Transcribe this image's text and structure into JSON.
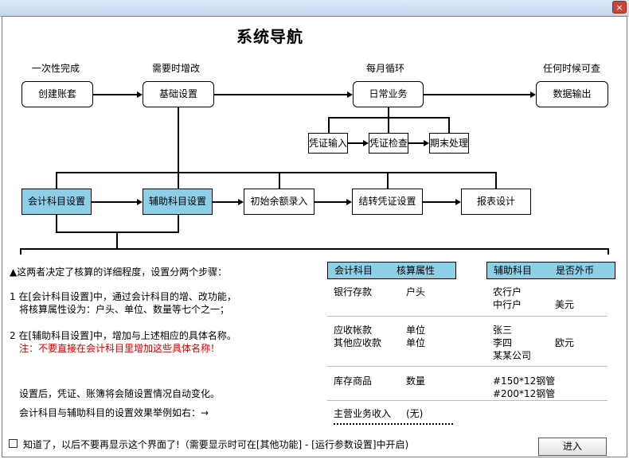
{
  "window": {
    "close_glyph": "×"
  },
  "title": "系统导航",
  "flow": {
    "top_labels": [
      "一次性完成",
      "需要时增改",
      "每月循环",
      "任何时候可查"
    ],
    "top_boxes": [
      "创建账套",
      "基础设置",
      "日常业务",
      "数据输出"
    ],
    "sub_boxes": [
      "凭证输入",
      "凭证检查",
      "期末处理"
    ],
    "mid_boxes": [
      "会计科目设置",
      "辅助科目设置",
      "初始余额录入",
      "结转凭证设置",
      "报表设计"
    ]
  },
  "notes": {
    "intro": "▲这两者决定了核算的详细程度，设置分两个步骤：",
    "step1_line1": "1 在[会计科目设置]中，通过会计科目的增、改功能，",
    "step1_line2": "将核算属性设为：户头、单位、数量等七个之一；",
    "step2_line1": "2 在[辅助科目设置]中，增加与上述相应的具体名称。",
    "step2_warning": "注：不要直接在会计科目里增加这些具体名称！",
    "after_setup": "设置后，凭证、账簿将会随设置情况自动变化。",
    "example_intro": "会计科目与辅助科目的设置效果举例如右：→"
  },
  "table": {
    "left_headers": [
      "会计科目",
      "核算属性"
    ],
    "right_headers": [
      "辅助科目",
      "是否外币"
    ],
    "groups": [
      {
        "left": [
          [
            "银行存款",
            "户头"
          ]
        ],
        "right": [
          [
            "农行户",
            ""
          ],
          [
            "中行户",
            "美元"
          ]
        ]
      },
      {
        "left": [
          [
            "应收帐款",
            "单位"
          ],
          [
            "其他应收款",
            "单位"
          ]
        ],
        "right": [
          [
            "张三",
            ""
          ],
          [
            "李四",
            "欧元"
          ],
          [
            "某某公司",
            ""
          ]
        ]
      },
      {
        "left": [
          [
            "库存商品",
            "数量"
          ]
        ],
        "right": [
          [
            "#150*12钢管",
            ""
          ],
          [
            "#200*12钢管",
            ""
          ]
        ]
      },
      {
        "left": [
          [
            "主营业务收入",
            "(无)"
          ]
        ],
        "right": []
      }
    ]
  },
  "footer": {
    "checkbox_label": "知道了，以后不要再显示这个界面了!（需要显示时可在[其他功能] - [运行参数设置]中开启)",
    "enter_button": "进入"
  },
  "colors": {
    "accent": "#8ecfe8",
    "warning": "#d40000"
  }
}
